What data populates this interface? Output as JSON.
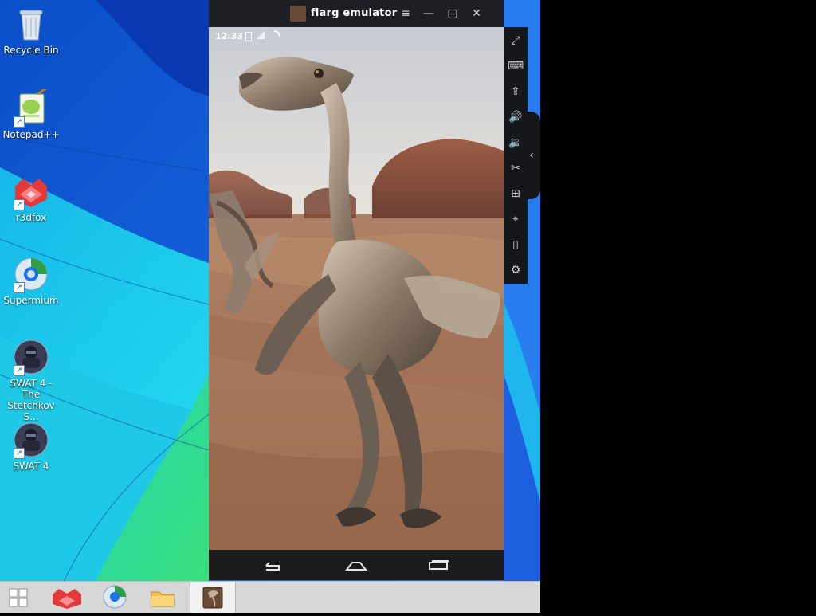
{
  "desktop": {
    "icons": [
      {
        "label": "Recycle Bin",
        "icon": "recycle-bin-icon"
      },
      {
        "label": "Notepad++",
        "icon": "notepadpp-icon"
      },
      {
        "label": "r3dfox",
        "icon": "r3dfox-icon"
      },
      {
        "label": "Supermium",
        "icon": "supermium-icon"
      },
      {
        "label_line1": "SWAT 4 - The",
        "label_line2": "Stetchkov S...",
        "icon": "swat4-expansion-icon"
      },
      {
        "label": "SWAT 4",
        "icon": "swat4-icon"
      }
    ]
  },
  "emulator": {
    "title": "flarg emulator",
    "controls": [
      "menu-icon",
      "minimize-icon",
      "maximize-icon",
      "close-icon"
    ],
    "status": {
      "time": "12:33"
    },
    "sidebar": [
      "fullscreen-icon",
      "keyboard-icon",
      "apk-install-icon",
      "volume-up-icon",
      "volume-down-icon",
      "screenshot-cut-icon",
      "multi-instance-icon",
      "location-icon",
      "shake-icon",
      "settings-icon"
    ],
    "nav": [
      "back-icon",
      "home-icon",
      "recents-icon"
    ]
  },
  "taskbar": {
    "items": [
      "start-icon",
      "r3dfox-icon",
      "supermium-icon",
      "file-explorer-icon",
      "flarg-emulator-icon"
    ],
    "active": "flarg-emulator-icon"
  },
  "colors": {
    "titlebar": "#1e1f24",
    "taskbar": "#d7d7d7",
    "wallpaper_blue": "#0b5fd6",
    "wallpaper_cyan": "#12c6e6",
    "wallpaper_green": "#2fd98f"
  }
}
